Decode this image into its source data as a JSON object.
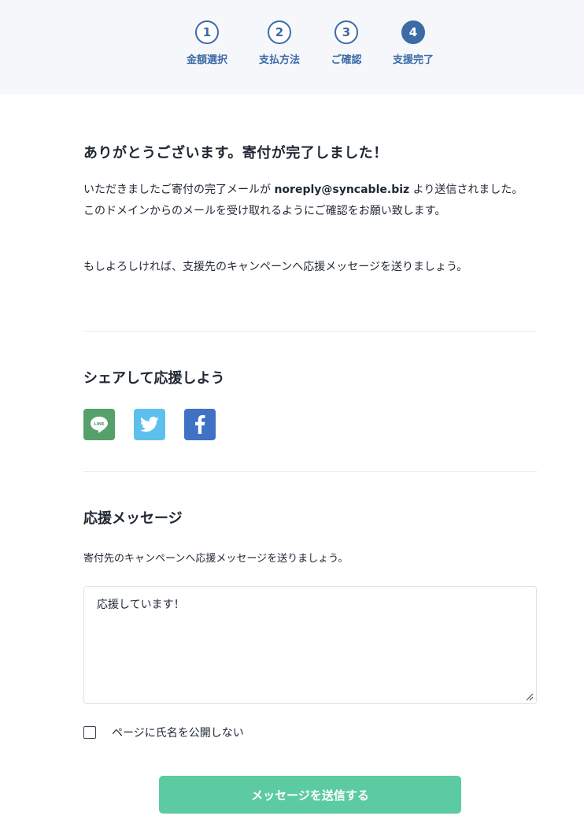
{
  "stepper": {
    "steps": [
      {
        "number": "1",
        "label": "金額選択",
        "state": "done"
      },
      {
        "number": "2",
        "label": "支払方法",
        "state": "done"
      },
      {
        "number": "3",
        "label": "ご確認",
        "state": "done"
      },
      {
        "number": "4",
        "label": "支援完了",
        "state": "current"
      }
    ]
  },
  "thanks": {
    "title": "ありがとうございます。寄付が完了しました！",
    "p1_before": "いただきましたご寄付の完了メールが ",
    "p1_email": "noreply@syncable.biz",
    "p1_after": " より送信されました。このドメインからのメールを受け取れるようにご確認をお願い致します。",
    "p2": "もしよろしければ、支援先のキャンペーンへ応援メッセージを送りましょう。"
  },
  "share": {
    "title": "シェアして応援しよう",
    "line_text": "LINE",
    "icons": [
      "line-icon",
      "twitter-icon",
      "facebook-icon"
    ]
  },
  "message": {
    "title": "応援メッセージ",
    "description": "寄付先のキャンペーンへ応援メッセージを送りましょう。",
    "value": "応援しています！",
    "anonymous_label": "ページに氏名を公開しない",
    "anonymous_checked": false,
    "submit_label": "メッセージを送信する"
  },
  "colors": {
    "accent": "#3d6ba6",
    "submit": "#5ccba2",
    "line": "#56a06b",
    "twitter": "#5dc0ec",
    "facebook": "#3f72c4"
  }
}
